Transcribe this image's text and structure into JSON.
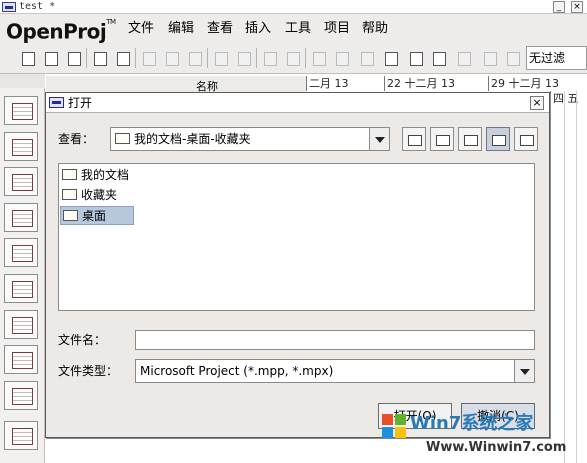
{
  "window": {
    "title": "test *",
    "minimize": "_",
    "close": "×"
  },
  "logo": {
    "name": "OpenProj",
    "tm": "TM"
  },
  "menu": [
    "文件",
    "编辑",
    "查看",
    "插入",
    "工具",
    "项目",
    "帮助"
  ],
  "toolbar": {
    "filter": "无过滤"
  },
  "gantt_header": {
    "col_header": "名称",
    "weeks": [
      "二月 13",
      "22 十二月 13",
      "29 十二月 13"
    ],
    "days": "四 五"
  },
  "dialog": {
    "title": "打开",
    "close": "×",
    "look_in_label": "查看：",
    "look_in_value": "我的文档-桌面-收藏夹",
    "files": [
      "我的文档",
      "收藏夹",
      "桌面"
    ],
    "selected_file": "桌面",
    "filename_label": "文件名：",
    "filename_value": "",
    "filetype_label": "文件类型：",
    "filetype_value": "Microsoft Project (*.mpp, *.mpx)",
    "open_button": "打开(O)",
    "cancel_button": "撤消(C)"
  },
  "watermark": {
    "text": "Win7系统之家",
    "url": "Www.Winwin7.com"
  },
  "colors": {
    "selection": "#b8c8dc",
    "accent": "#2a2a8a",
    "watermark": "#2a7ab8"
  }
}
